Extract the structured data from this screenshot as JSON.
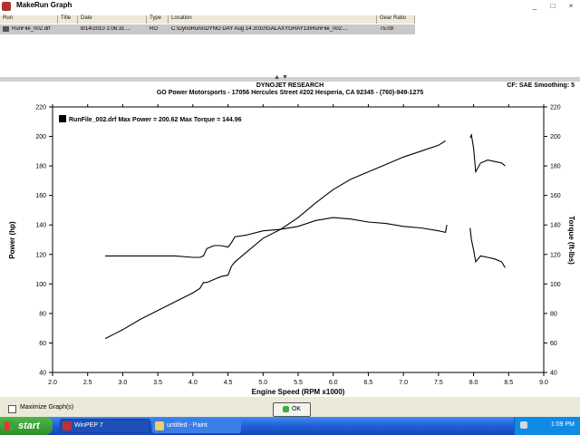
{
  "window": {
    "title": "MakeRun Graph",
    "buttons": [
      "_",
      "□",
      "×"
    ]
  },
  "runlist": {
    "columns": [
      "Run",
      "Title",
      "Date",
      "Type",
      "Location",
      "Gear Ratio"
    ],
    "rows": [
      {
        "run": "RunFile_002.drf",
        "title": "",
        "date": "8/14/2010 1:06:31 ...",
        "type": "RO",
        "location": "C:\\DynoRuns\\DYNO DAY Aug 14 2010\\GALAXYGRAY13\\RunFile_002....",
        "gear_ratio": "75.09"
      }
    ]
  },
  "graph": {
    "heading1": "DYNOJET RESEARCH",
    "heading2": "GO Power Motorsports - 17056 Hercules Street #202 Hesperia, CA 92345 - (760)-949-1275",
    "cf_smoothing": "CF: SAE  Smoothing: 5",
    "legend": "RunFile_002.drf Max Power = 200.62 Max Torque = 144.96",
    "left_axis_label": "Power (hp)",
    "right_axis_label": "Torque (ft-lbs)",
    "x_axis_label": "Engine Speed (RPM x1000)"
  },
  "chart_data": {
    "type": "line",
    "xlabel": "Engine Speed (RPM x1000)",
    "ylabel": "Power (hp)",
    "y2label": "Torque (ft-lbs)",
    "xlim": [
      2.0,
      9.0
    ],
    "ylim": [
      40,
      220
    ],
    "y2lim": [
      40,
      220
    ],
    "x_ticks": [
      "2.0",
      "2.5",
      "3.0",
      "3.5",
      "4.0",
      "4.5",
      "5.0",
      "5.5",
      "6.0",
      "6.5",
      "7.0",
      "7.5",
      "8.0",
      "8.5",
      "9.0"
    ],
    "y_ticks": [
      "40",
      "60",
      "80",
      "100",
      "120",
      "140",
      "160",
      "180",
      "200",
      "220"
    ],
    "grid": false,
    "legend_position": "top-left",
    "series": [
      {
        "name": "Power",
        "segments": [
          {
            "x": [
              2.75,
              3.0,
              3.25,
              3.5,
              3.75,
              4.0,
              4.1,
              4.15,
              4.2,
              4.3,
              4.4,
              4.5,
              4.55,
              4.6,
              4.75,
              5.0,
              5.25,
              5.5,
              5.75,
              6.0,
              6.25,
              6.5,
              6.75,
              7.0,
              7.25,
              7.5,
              7.6
            ],
            "y": [
              63,
              69,
              76,
              82,
              88,
              94,
              97,
              101,
              101,
              103,
              105,
              106,
              112,
              115,
              121,
              131,
              137,
              145,
              155,
              164,
              171,
              176,
              181,
              186,
              190,
              194,
              197
            ]
          },
          {
            "x": [
              7.95,
              7.97,
              8.0,
              8.03,
              8.1,
              8.2,
              8.3,
              8.4,
              8.45
            ],
            "y": [
              199,
              201,
              192,
              176,
              182,
              184,
              183,
              182,
              180
            ]
          }
        ]
      },
      {
        "name": "Torque",
        "segments": [
          {
            "x": [
              2.75,
              3.0,
              3.25,
              3.5,
              3.75,
              4.0,
              4.1,
              4.15,
              4.2,
              4.3,
              4.4,
              4.5,
              4.55,
              4.6,
              4.75,
              5.0,
              5.25,
              5.5,
              5.75,
              6.0,
              6.25,
              6.5,
              6.75,
              7.0,
              7.25,
              7.5,
              7.6,
              7.62
            ],
            "y": [
              119,
              119,
              119,
              119,
              119,
              118,
              118,
              119,
              124,
              126,
              126,
              125,
              128,
              132,
              133,
              136,
              137,
              139,
              143,
              145,
              144,
              142,
              141,
              139,
              138,
              136,
              135,
              140
            ]
          },
          {
            "x": [
              7.95,
              7.97,
              8.0,
              8.03,
              8.1,
              8.2,
              8.3,
              8.4,
              8.45
            ],
            "y": [
              138,
              130,
              123,
              115,
              119,
              118,
              117,
              115,
              111
            ]
          }
        ]
      }
    ]
  },
  "bottom": {
    "maximize_label": "Maximize Graph(s)",
    "ok_label": "OK"
  },
  "taskbar": {
    "start_label": "start",
    "task1": "WinPEP 7",
    "task2": "untitled - Paint",
    "clock": "1:09 PM"
  }
}
